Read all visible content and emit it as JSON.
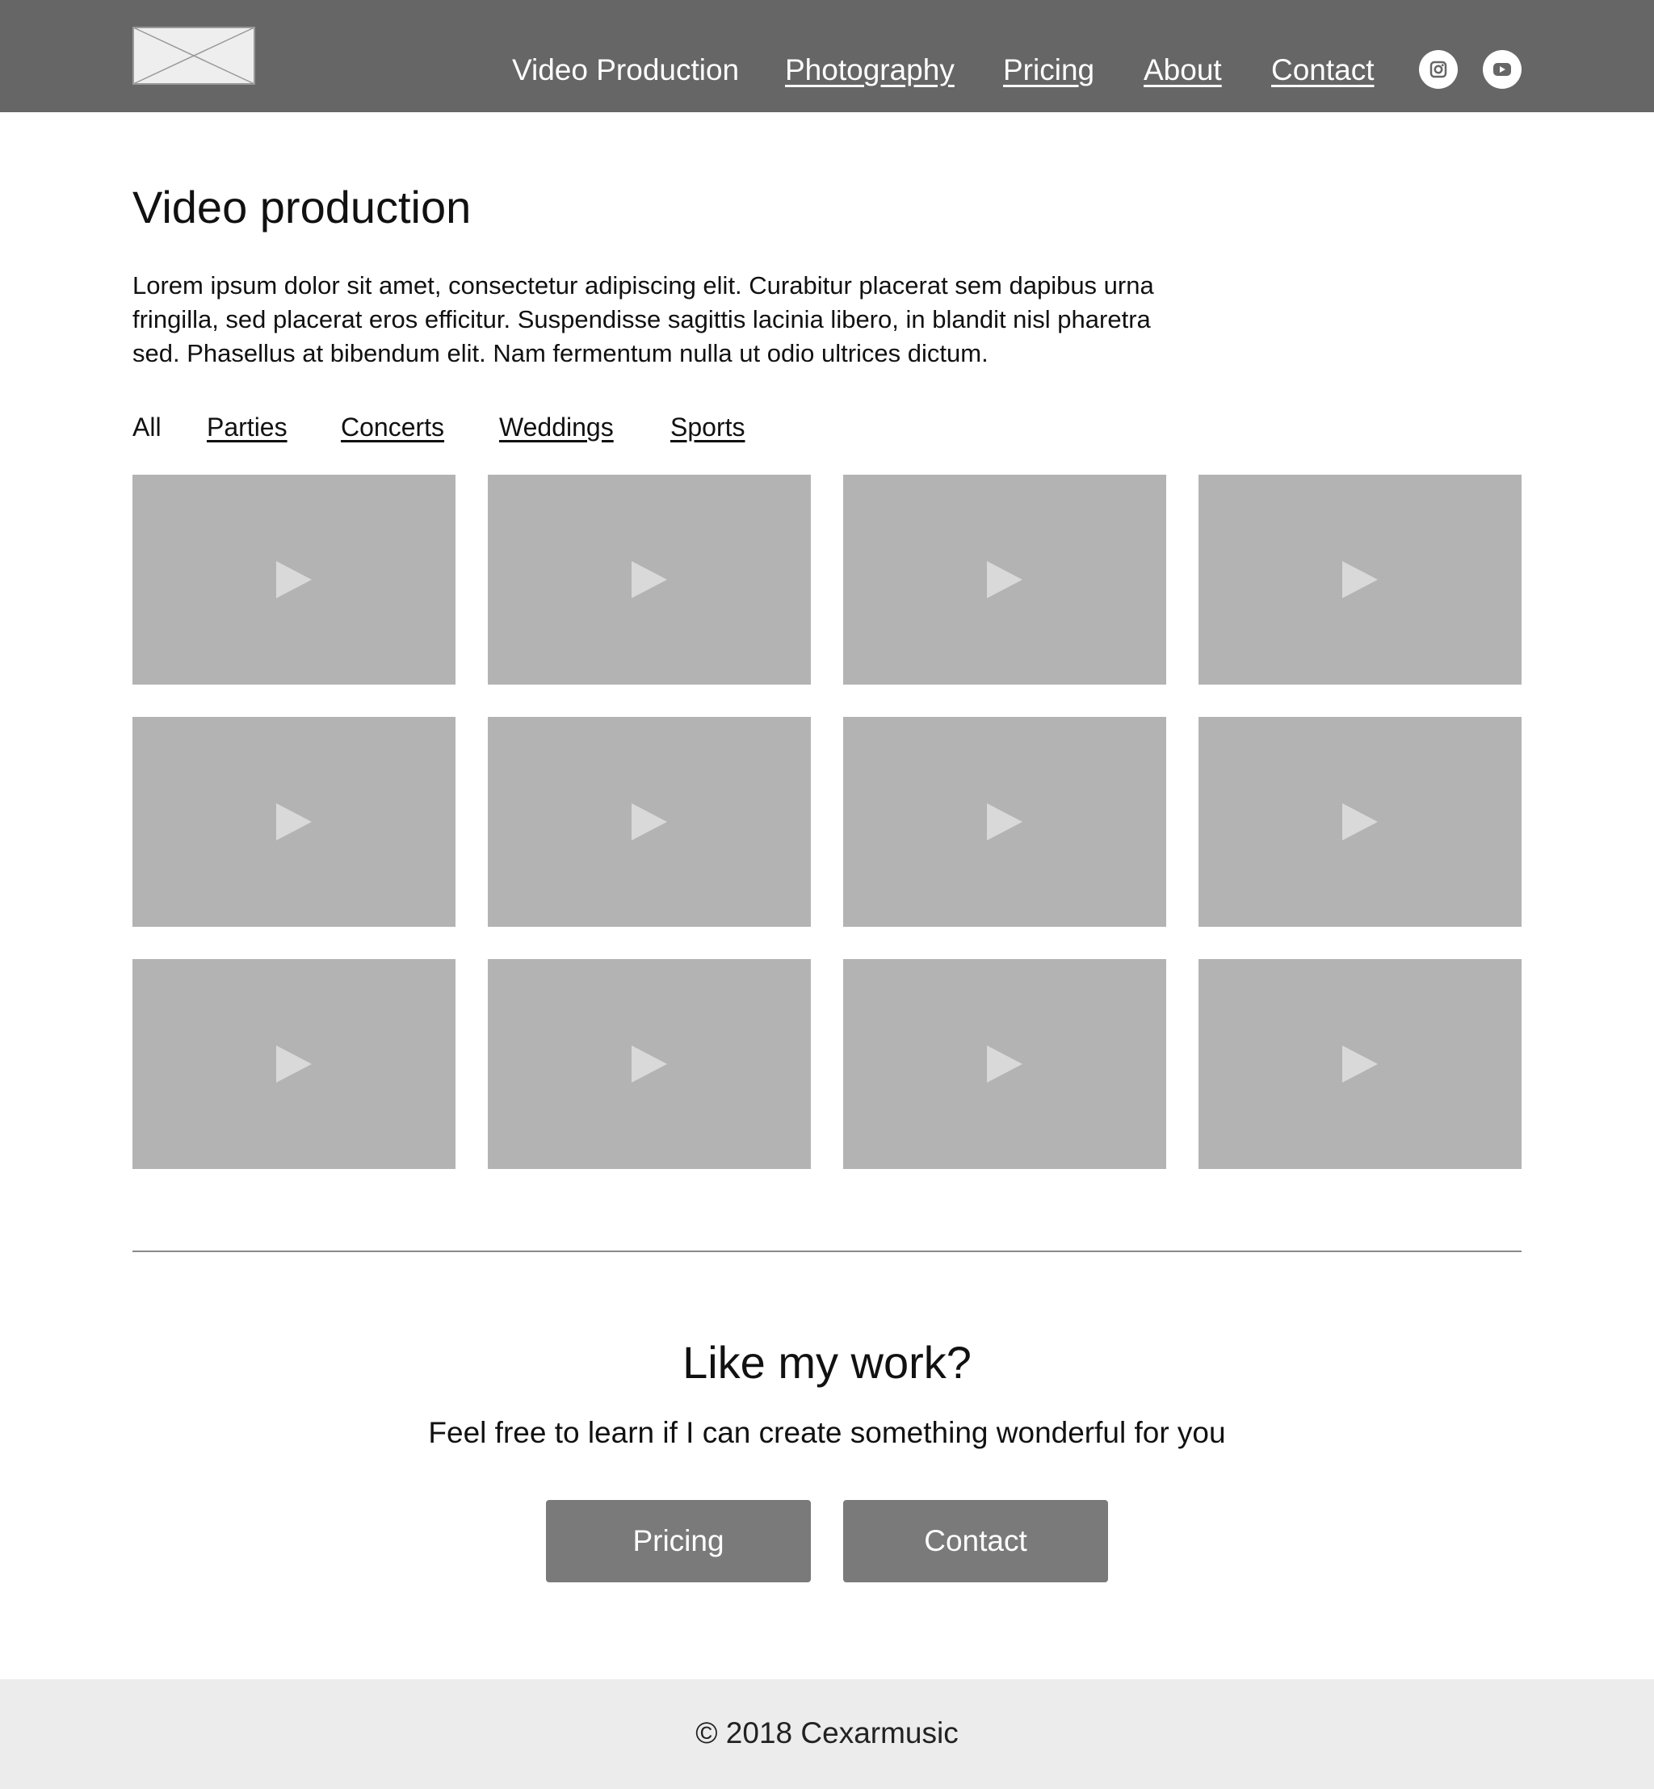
{
  "header": {
    "nav": [
      {
        "label": "Video Production"
      },
      {
        "label": "Photography"
      },
      {
        "label": "Pricing"
      },
      {
        "label": "About"
      },
      {
        "label": "Contact"
      }
    ],
    "social": [
      {
        "icon": "instagram-icon"
      },
      {
        "icon": "youtube-icon"
      }
    ]
  },
  "intro": {
    "title": "Video production",
    "text": "Lorem ipsum dolor sit amet, consectetur adipiscing elit. Curabitur placerat sem dapibus urna fringilla, sed placerat eros efficitur. Suspendisse sagittis lacinia libero, in blandit nisl pharetra sed. Phasellus at bibendum elit. Nam fermentum nulla ut odio ultrices dictum."
  },
  "filters": [
    {
      "label": "All"
    },
    {
      "label": "Parties"
    },
    {
      "label": "Concerts"
    },
    {
      "label": "Weddings"
    },
    {
      "label": "Sports"
    }
  ],
  "videos": {
    "icon": "play-icon",
    "tiles": [
      1,
      2,
      3,
      4,
      5,
      6,
      7,
      8,
      9,
      10,
      11,
      12
    ]
  },
  "cta": {
    "title": "Like my work?",
    "text": "Feel free to learn if I can create something wonderful for you",
    "pricing_label": "Pricing",
    "contact_label": "Contact"
  },
  "footer": {
    "copyright": "© 2018 Cexarmusic"
  },
  "colors": {
    "header_bg": "#666666",
    "tile_bg": "#b3b3b3",
    "button_bg": "#7a7a7a",
    "footer_bg": "#ececec"
  }
}
